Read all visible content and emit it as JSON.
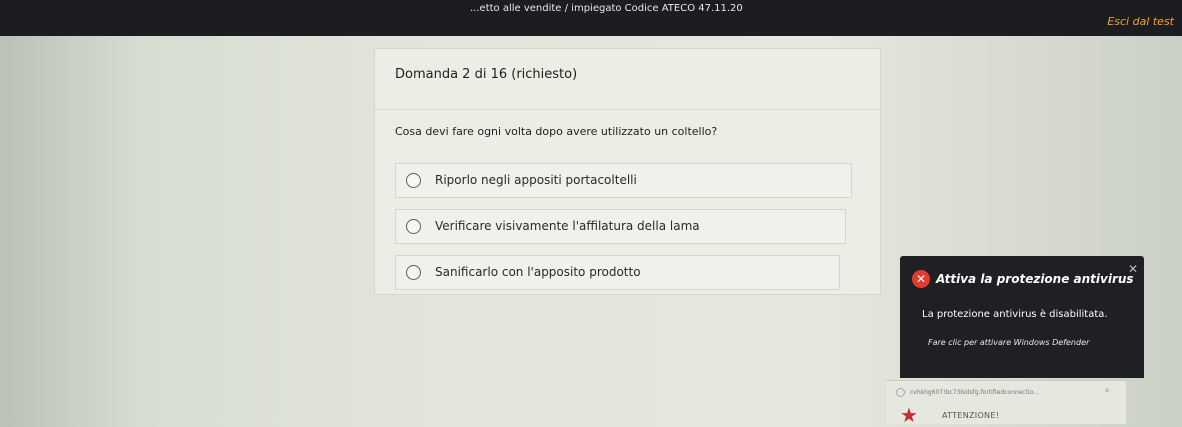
{
  "header": {
    "title": "...etto alle vendite / impiegato Codice ATECO 47.11.20",
    "exit_label": "Esci dal test"
  },
  "question": {
    "number_label": "Domanda 2 di 16 (richiesto)",
    "text": "Cosa devi fare ogni volta dopo avere utilizzato un coltello?",
    "options": [
      {
        "label": "Riporlo negli appositi portacoltelli",
        "selected": false
      },
      {
        "label": "Verificare visivamente l'affilatura della lama",
        "selected": false
      },
      {
        "label": "Sanificarlo con l'apposito prodotto",
        "selected": false
      }
    ]
  },
  "toast": {
    "title": "Attiva la protezione antivirus",
    "body": "La protezione antivirus è disabilitata.",
    "link": "Fare clic per attivare Windows Defender",
    "icon": "error-x-icon",
    "icon_color": "#e23a2d"
  },
  "notification": {
    "url": "cvhkhg607!bc73bidsfg.fortifiedconnectio...",
    "warning": "ATTENZIONE!"
  },
  "colors": {
    "accent_orange": "#f1a22c",
    "panel_bg": "#eceee6",
    "toast_bg": "#1e2023"
  }
}
